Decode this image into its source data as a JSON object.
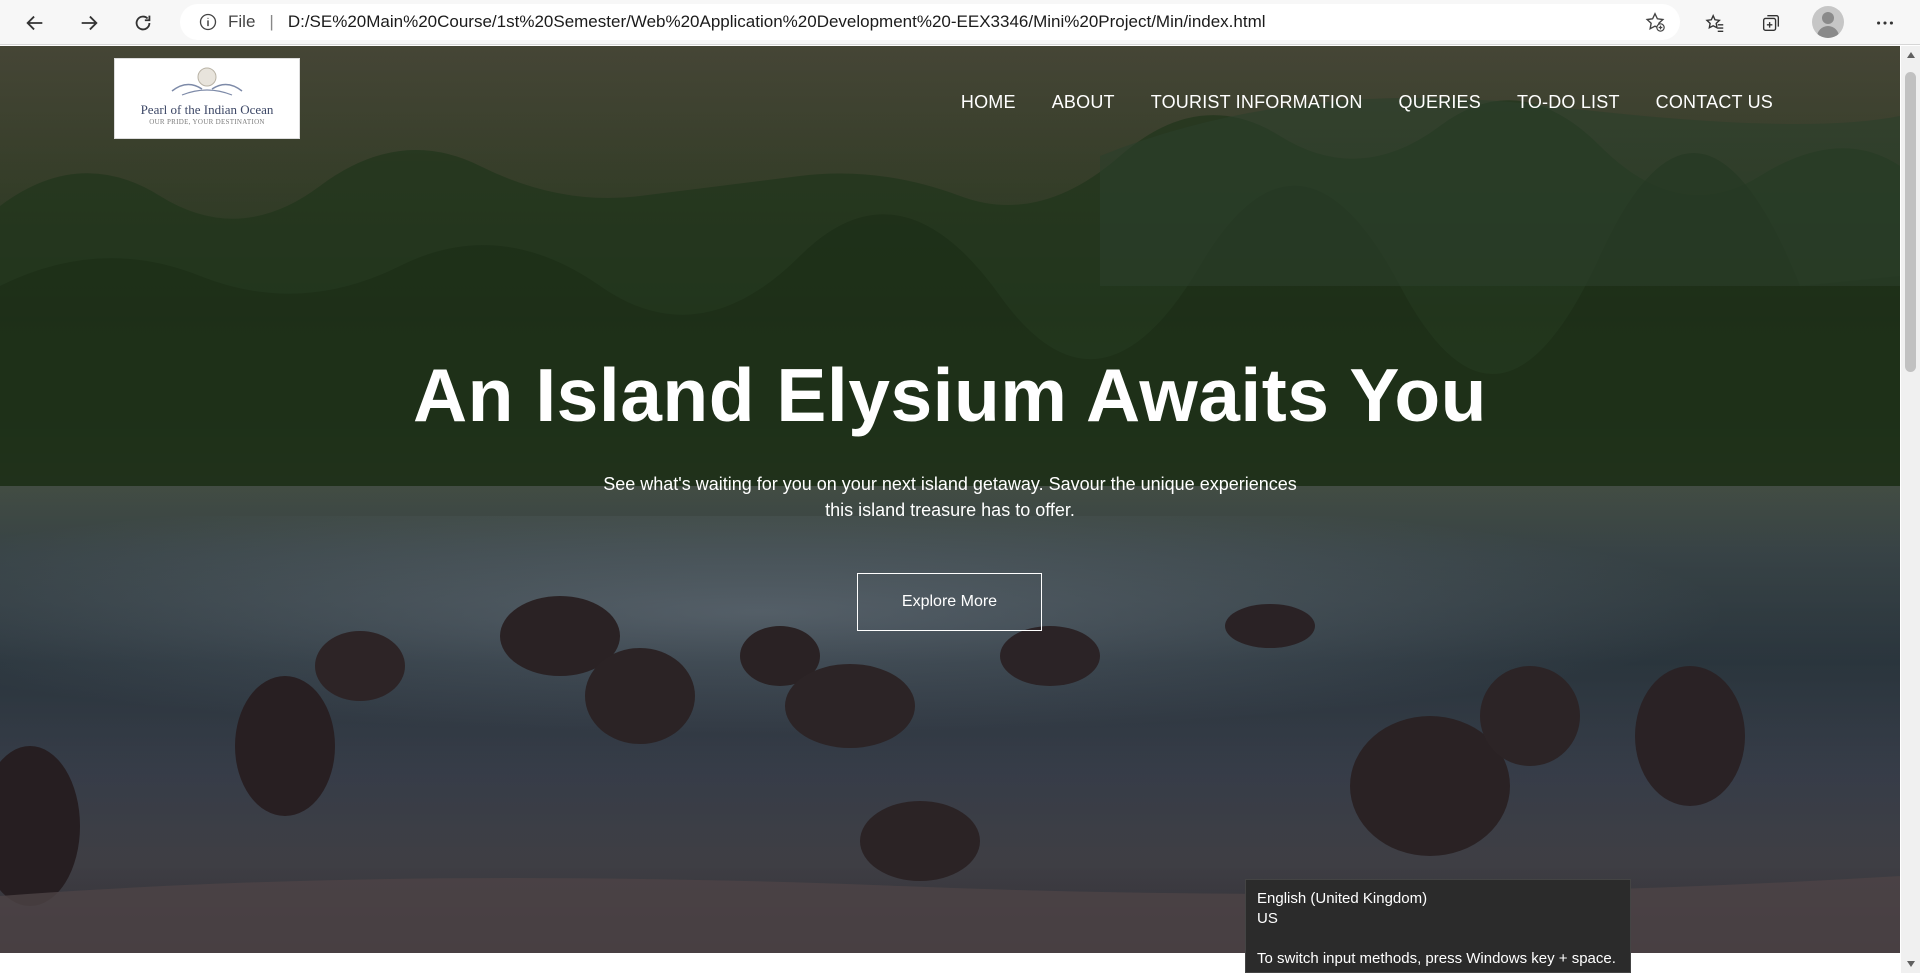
{
  "browser": {
    "file_label": "File",
    "url": "D:/SE%20Main%20Course/1st%20Semester/Web%20Application%20Development%20-EEX3346/Mini%20Project/Min/index.html"
  },
  "site": {
    "logo": {
      "title": "Pearl of the Indian Ocean",
      "tagline": "OUR PRIDE, YOUR DESTINATION"
    },
    "nav": [
      {
        "label": "HOME"
      },
      {
        "label": "ABOUT"
      },
      {
        "label": "TOURIST INFORMATION"
      },
      {
        "label": "QUERIES"
      },
      {
        "label": "TO-DO LIST"
      },
      {
        "label": "CONTACT US"
      }
    ],
    "hero": {
      "title": "An Island Elysium Awaits You",
      "subtitle": "See what's waiting for you on your next island getaway. Savour the unique experiences this island treasure has to offer.",
      "cta": "Explore More"
    }
  },
  "ime_tooltip": {
    "language": "English (United Kingdom)",
    "layout": "US",
    "hint": "To switch input methods, press Windows key + space."
  },
  "icons": [
    "back-icon",
    "forward-icon",
    "refresh-icon",
    "info-icon",
    "add-favorite-icon",
    "favorites-icon",
    "collections-icon",
    "profile-icon",
    "more-icon"
  ]
}
